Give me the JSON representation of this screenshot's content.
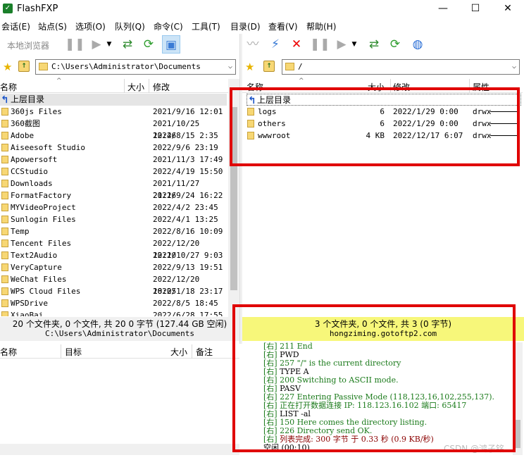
{
  "window": {
    "title": "FlashFXP",
    "minimize": "—",
    "maximize": "☐",
    "close": "✕"
  },
  "menu": [
    "会话(E)",
    "站点(S)",
    "选项(O)",
    "队列(Q)",
    "命令(C)",
    "工具(T)",
    "目录(D)",
    "查看(V)",
    "帮助(H)"
  ],
  "left_toolbar": {
    "label": "本地浏览器"
  },
  "left_path": "C:\\Users\\Administrator\\Documents",
  "right_path": "/",
  "left_columns": {
    "name": "名称",
    "size": "大小",
    "modified": "修改"
  },
  "right_columns": {
    "name": "名称",
    "size": "大小",
    "modified": "修改",
    "attr": "属性"
  },
  "parent_dir": "上层目录",
  "left_files": [
    {
      "name": "360js Files",
      "date": "2021/9/16 12:01"
    },
    {
      "name": "360截图",
      "date": "2021/10/25 12:46"
    },
    {
      "name": "Adobe",
      "date": "2022/8/15 2:35"
    },
    {
      "name": "Aiseesoft Studio",
      "date": "2022/9/6 23:19"
    },
    {
      "name": "Apowersoft",
      "date": "2021/11/3 17:49"
    },
    {
      "name": "CCStudio",
      "date": "2022/4/19 15:50"
    },
    {
      "name": "Downloads",
      "date": "2021/11/27 21:16"
    },
    {
      "name": "FormatFactory",
      "date": "2022/9/24 16:22"
    },
    {
      "name": "MYVideoProject",
      "date": "2022/4/2 23:45"
    },
    {
      "name": "Sunlogin Files",
      "date": "2022/4/1 13:25"
    },
    {
      "name": "Temp",
      "date": "2022/8/16 10:09"
    },
    {
      "name": "Tencent Files",
      "date": "2022/12/20 12:10"
    },
    {
      "name": "Text2Audio",
      "date": "2022/10/27 9:03"
    },
    {
      "name": "VeryCapture",
      "date": "2022/9/13 19:51"
    },
    {
      "name": "WeChat Files",
      "date": "2022/12/20 18:05"
    },
    {
      "name": "WPS Cloud Files",
      "date": "2022/1/18 23:17"
    },
    {
      "name": "WPSDrive",
      "date": "2022/8/5 18:45"
    },
    {
      "name": "XiaoBai",
      "date": "2022/6/28 17:55"
    }
  ],
  "right_files": [
    {
      "name": "logs",
      "size": "6",
      "date": "2022/1/29 0:00",
      "attr": "drwx"
    },
    {
      "name": "others",
      "size": "6",
      "date": "2022/1/29 0:00",
      "attr": "drwx"
    },
    {
      "name": "wwwroot",
      "size": "4 KB",
      "date": "2022/12/17 6:07",
      "attr": "drwx"
    }
  ],
  "left_status": {
    "line1": "20 个文件夹, 0 个文件, 共 20 0 字节 (127.44 GB 空闲)",
    "line2": "C:\\Users\\Administrator\\Documents"
  },
  "right_status": {
    "line1": "3 个文件夹, 0 个文件, 共 3 (0 字节)",
    "line2": "hongziming.gotoftp2.com"
  },
  "queue_columns": {
    "name": "名称",
    "target": "目标",
    "size": "大小",
    "note": "备注"
  },
  "log": [
    {
      "prefix": "[右]",
      "text": "211 End",
      "color": "#1a7a1a"
    },
    {
      "prefix": "[右]",
      "text": "PWD",
      "color": "#000000"
    },
    {
      "prefix": "[右]",
      "text": "257 \"/\" is the current directory",
      "color": "#1a7a1a"
    },
    {
      "prefix": "[右]",
      "text": "TYPE A",
      "color": "#000000"
    },
    {
      "prefix": "[右]",
      "text": "200 Switching to ASCII mode.",
      "color": "#1a7a1a"
    },
    {
      "prefix": "[右]",
      "text": "PASV",
      "color": "#000000"
    },
    {
      "prefix": "[右]",
      "text": "227 Entering Passive Mode (118,123,16,102,255,137).",
      "color": "#1a7a1a"
    },
    {
      "prefix": "[右]",
      "text": "正在打开数据连接 IP: 118.123.16.102 端口: 65417",
      "color": "#1a7a1a"
    },
    {
      "prefix": "[右]",
      "text": "LIST -al",
      "color": "#000000"
    },
    {
      "prefix": "[右]",
      "text": "150 Here comes the directory listing.",
      "color": "#1a7a1a"
    },
    {
      "prefix": "[右]",
      "text": "226 Directory send OK.",
      "color": "#1a7a1a"
    },
    {
      "prefix": "[右]",
      "text": "列表完成: 300 字节 于 0.33 秒 (0.9 KB/秒)",
      "color": "#8b0000"
    },
    {
      "prefix": "",
      "text": "空闲 (00:10)",
      "color": "#000000"
    }
  ],
  "watermark": "CSDN @鸿子铭",
  "colors": {
    "status_highlight": "#f7f77a",
    "red_annotation": "#e00000",
    "selected_toolbar": "#cce4f7"
  }
}
